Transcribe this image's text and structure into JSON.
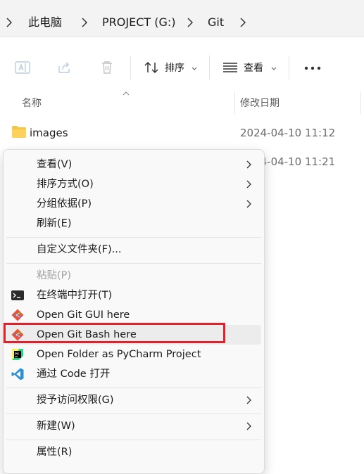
{
  "breadcrumb": {
    "items": [
      "此电脑",
      "PROJECT (G:)",
      "Git"
    ]
  },
  "toolbar": {
    "sort_label": "排序",
    "view_label": "查看"
  },
  "columns": {
    "name": "名称",
    "modified": "修改日期"
  },
  "files": [
    {
      "name": "images",
      "modified": "2024-04-10 11:12",
      "type": "folder"
    },
    {
      "name": "",
      "modified": "2024-04-10 11:21",
      "type": "file"
    }
  ],
  "context_menu": {
    "items": [
      {
        "label": "查看(V)",
        "submenu": true
      },
      {
        "label": "排序方式(O)",
        "submenu": true
      },
      {
        "label": "分组依据(P)",
        "submenu": true
      },
      {
        "label": "刷新(E)",
        "submenu": false
      },
      {
        "label": "自定义文件夹(F)...",
        "submenu": false
      },
      {
        "label": "粘贴(P)",
        "submenu": false,
        "disabled": true
      },
      {
        "label": "在终端中打开(T)",
        "icon": "terminal-icon"
      },
      {
        "label": "Open Git GUI here",
        "icon": "git-icon"
      },
      {
        "label": "Open Git Bash here",
        "icon": "git-icon",
        "highlighted": true
      },
      {
        "label": "Open Folder as PyCharm Project",
        "icon": "pycharm-icon"
      },
      {
        "label": "通过 Code 打开",
        "icon": "vscode-icon"
      },
      {
        "label": "授予访问权限(G)",
        "submenu": true
      },
      {
        "label": "新建(W)",
        "submenu": true
      },
      {
        "label": "属性(R)",
        "submenu": false
      }
    ]
  },
  "colors": {
    "highlight_border": "#e0212b",
    "folder": "#f8c542",
    "git": "#f05133",
    "vscode": "#2a8fd8"
  }
}
